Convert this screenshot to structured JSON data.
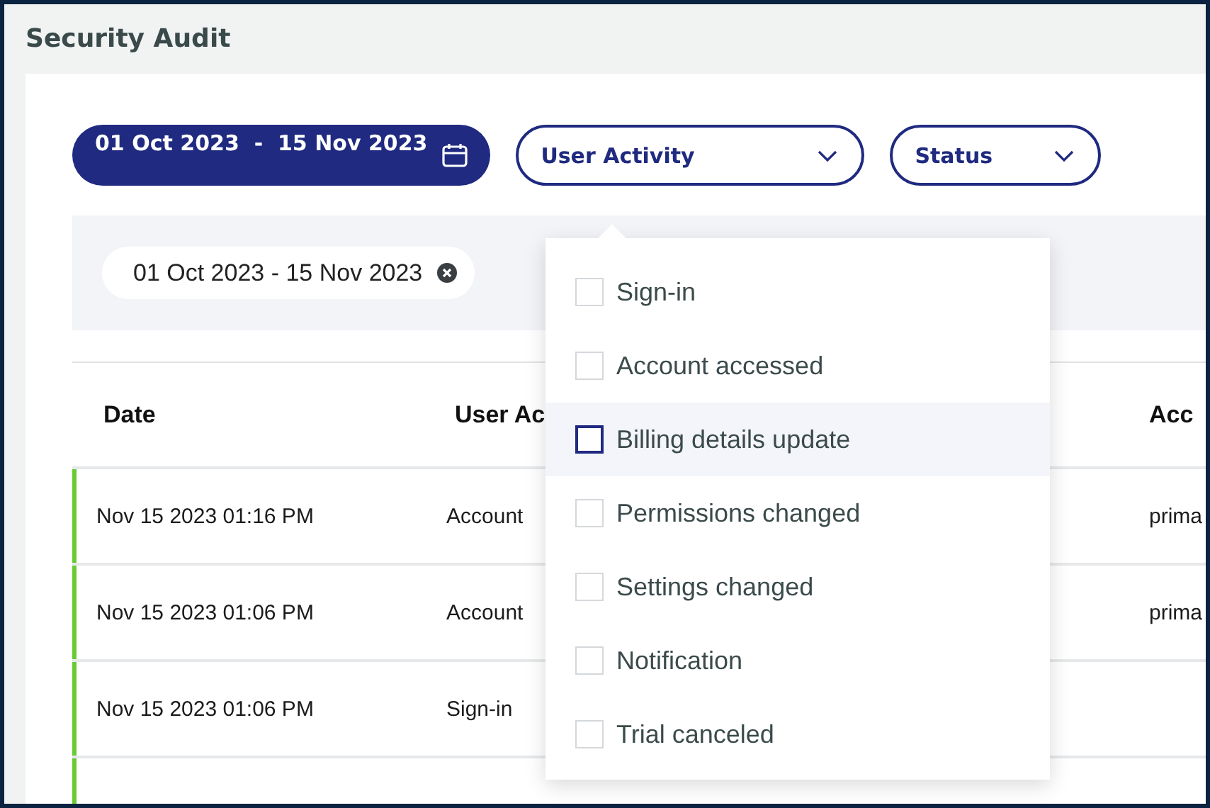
{
  "page": {
    "title": "Security Audit"
  },
  "filters": {
    "date_range": "01 Oct 2023  -  15 Nov 2023",
    "dropdowns": [
      {
        "label": "User Activity"
      },
      {
        "label": "Status"
      }
    ]
  },
  "chips": [
    {
      "label": "01 Oct 2023 - 15 Nov 2023"
    }
  ],
  "table": {
    "columns": [
      "Date",
      "User Ac",
      "Acc"
    ],
    "rows": [
      {
        "color": "#66cc33",
        "cells": [
          "Nov 15 2023 01:16 PM",
          "Account",
          "prima"
        ]
      },
      {
        "color": "#66cc33",
        "cells": [
          "Nov 15 2023 01:06 PM",
          "Account",
          "prima"
        ]
      },
      {
        "color": "#66cc33",
        "cells": [
          "Nov 15 2023 01:06 PM",
          "Sign-in",
          ""
        ]
      },
      {
        "color": "#66cc33",
        "cells": []
      }
    ]
  },
  "activity_menu": {
    "options": [
      {
        "label": "Sign-in",
        "checked": false,
        "focused": false
      },
      {
        "label": "Account accessed",
        "checked": false,
        "focused": false
      },
      {
        "label": "Billing details update",
        "checked": false,
        "focused": true
      },
      {
        "label": "Permissions changed",
        "checked": false,
        "focused": false
      },
      {
        "label": "Settings changed",
        "checked": false,
        "focused": false
      },
      {
        "label": "Notification",
        "checked": false,
        "focused": false
      },
      {
        "label": "Trial canceled",
        "checked": false,
        "focused": false
      }
    ]
  }
}
